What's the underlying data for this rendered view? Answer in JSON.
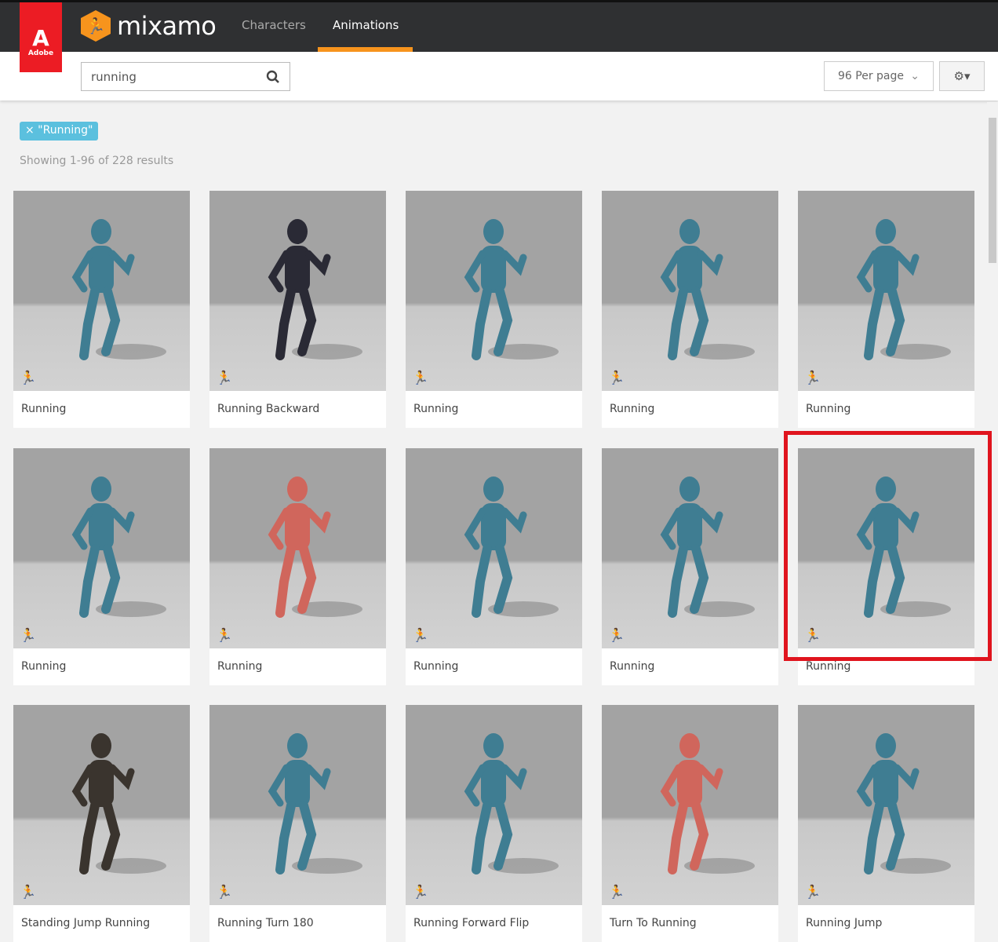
{
  "header": {
    "brand": "Adobe",
    "logo": "mixamo",
    "nav": [
      {
        "label": "Characters",
        "active": false
      },
      {
        "label": "Animations",
        "active": true
      }
    ],
    "accent": "#f7941d"
  },
  "toolbar": {
    "search_value": "running",
    "per_page": "96 Per page",
    "settings_icon": "gear-icon"
  },
  "filter": {
    "tag": "× \"Running\"",
    "results": "Showing 1-96 of 228 results"
  },
  "cards": [
    {
      "title": "Running",
      "figure": "teal"
    },
    {
      "title": "Running Backward",
      "figure": "girl"
    },
    {
      "title": "Running",
      "figure": "teal"
    },
    {
      "title": "Running",
      "figure": "teal"
    },
    {
      "title": "Running",
      "figure": "teal"
    },
    {
      "title": "Running",
      "figure": "teal"
    },
    {
      "title": "Running",
      "figure": "red"
    },
    {
      "title": "Running",
      "figure": "teal"
    },
    {
      "title": "Running",
      "figure": "teal"
    },
    {
      "title": "Running",
      "figure": "teal",
      "highlighted": true
    },
    {
      "title": "Standing Jump Running",
      "figure": "dark"
    },
    {
      "title": "Running Turn 180",
      "figure": "teal"
    },
    {
      "title": "Running Forward Flip",
      "figure": "teal"
    },
    {
      "title": "Turn To Running",
      "figure": "red"
    },
    {
      "title": "Running Jump",
      "figure": "teal"
    }
  ],
  "highlight_color": "#e0141e"
}
